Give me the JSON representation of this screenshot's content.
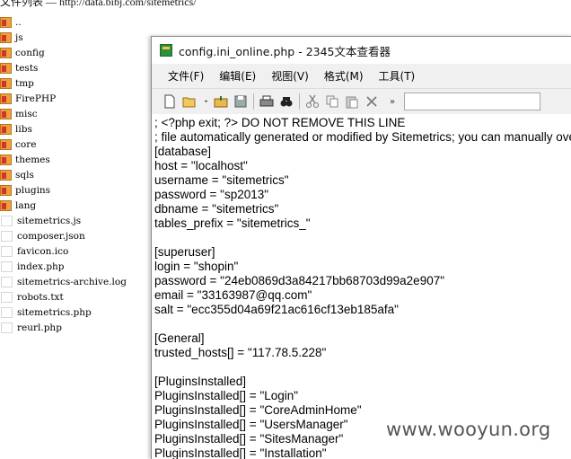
{
  "listing": {
    "title": "文件列表 — http://data.bibj.com/sitemetrics/",
    "entries": [
      {
        "name": "..",
        "type": "folder"
      },
      {
        "name": "js",
        "type": "folder"
      },
      {
        "name": "config",
        "type": "folder"
      },
      {
        "name": "tests",
        "type": "folder"
      },
      {
        "name": "tmp",
        "type": "folder"
      },
      {
        "name": "FirePHP",
        "type": "folder"
      },
      {
        "name": "misc",
        "type": "folder"
      },
      {
        "name": "libs",
        "type": "folder"
      },
      {
        "name": "core",
        "type": "folder"
      },
      {
        "name": "themes",
        "type": "folder"
      },
      {
        "name": "sqls",
        "type": "folder"
      },
      {
        "name": "plugins",
        "type": "folder"
      },
      {
        "name": "lang",
        "type": "folder"
      },
      {
        "name": "sitemetrics.js",
        "type": "file"
      },
      {
        "name": "composer.json",
        "type": "file"
      },
      {
        "name": "favicon.ico",
        "type": "file"
      },
      {
        "name": "index.php",
        "type": "file"
      },
      {
        "name": "sitemetrics-archive.log",
        "type": "file"
      },
      {
        "name": "robots.txt",
        "type": "file"
      },
      {
        "name": "sitemetrics.php",
        "type": "file"
      },
      {
        "name": "reurl.php",
        "type": "file"
      }
    ]
  },
  "viewer": {
    "title": "config.ini_online.php - 2345文本查看器",
    "menu": [
      "文件(F)",
      "编辑(E)",
      "视图(V)",
      "格式(M)",
      "工具(T)"
    ],
    "toolbar": [
      {
        "name": "new-file-icon"
      },
      {
        "name": "open-folder-icon"
      },
      {
        "name": "open-dropdown-icon"
      },
      {
        "name": "open-recent-icon"
      },
      {
        "name": "save-icon"
      },
      {
        "sep": true
      },
      {
        "name": "print-icon"
      },
      {
        "name": "find-icon"
      },
      {
        "sep": true
      },
      {
        "name": "cut-icon"
      },
      {
        "name": "copy-icon"
      },
      {
        "name": "paste-icon"
      },
      {
        "name": "delete-icon"
      }
    ],
    "lines": [
      "; <?php exit; ?> DO NOT REMOVE THIS LINE",
      "; file automatically generated or modified by Sitemetrics; you can manually override the default values",
      "[database]",
      "host = \"localhost\"",
      "username = \"sitemetrics\"",
      "password = \"sp2013\"",
      "dbname = \"sitemetrics\"",
      "tables_prefix = \"sitemetrics_\"",
      "",
      "[superuser]",
      "login = \"shopin\"",
      "password = \"24eb0869d3a84217bb68703d99a2e907\"",
      "email = \"33163987@qq.com\"",
      "salt = \"ecc355d04a69f21ac616cf13eb185afa\"",
      "",
      "[General]",
      "trusted_hosts[] = \"117.78.5.228\"",
      "",
      "[PluginsInstalled]",
      "PluginsInstalled[] = \"Login\"",
      "PluginsInstalled[] = \"CoreAdminHome\"",
      "PluginsInstalled[] = \"UsersManager\"",
      "PluginsInstalled[] = \"SitesManager\"",
      "PluginsInstalled[] = \"Installation\""
    ]
  },
  "watermark": "www.wooyun.org"
}
